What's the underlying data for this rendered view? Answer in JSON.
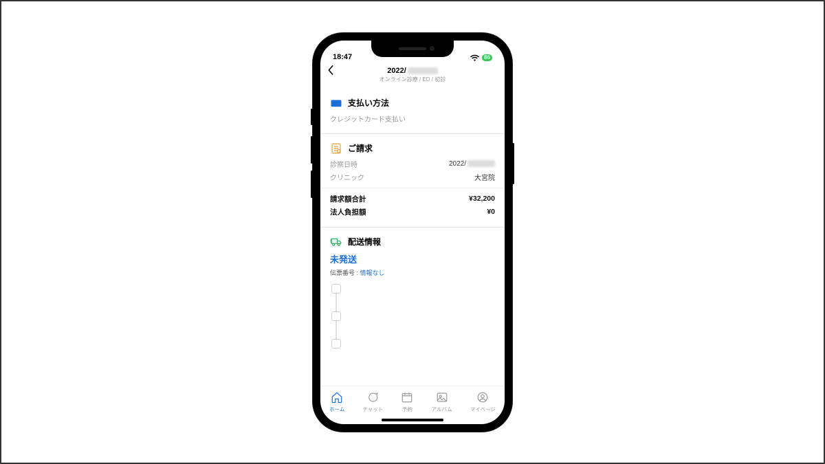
{
  "status": {
    "time": "18:47",
    "battery": "86"
  },
  "header": {
    "title_prefix": "2022/",
    "subtitle": "オンライン診療 / ED / 初診"
  },
  "payment": {
    "section_title": "支払い方法",
    "method": "クレジットカード支払い"
  },
  "billing": {
    "section_title": "ご請求",
    "rows": {
      "datetime_label": "診察日時",
      "datetime_value_prefix": "2022/",
      "clinic_label": "クリニック",
      "clinic_value": "大宮院",
      "total_label": "請求額合計",
      "total_value": "¥32,200",
      "corp_label": "法人負担額",
      "corp_value": "¥0"
    }
  },
  "shipping": {
    "section_title": "配送情報",
    "status": "未発送",
    "tracking_label": "伝票番号 :",
    "tracking_value": "情報なし"
  },
  "tabs": {
    "home": "ホーム",
    "chat": "チャット",
    "reserve": "予約",
    "album": "アルバム",
    "mypage": "マイページ"
  }
}
